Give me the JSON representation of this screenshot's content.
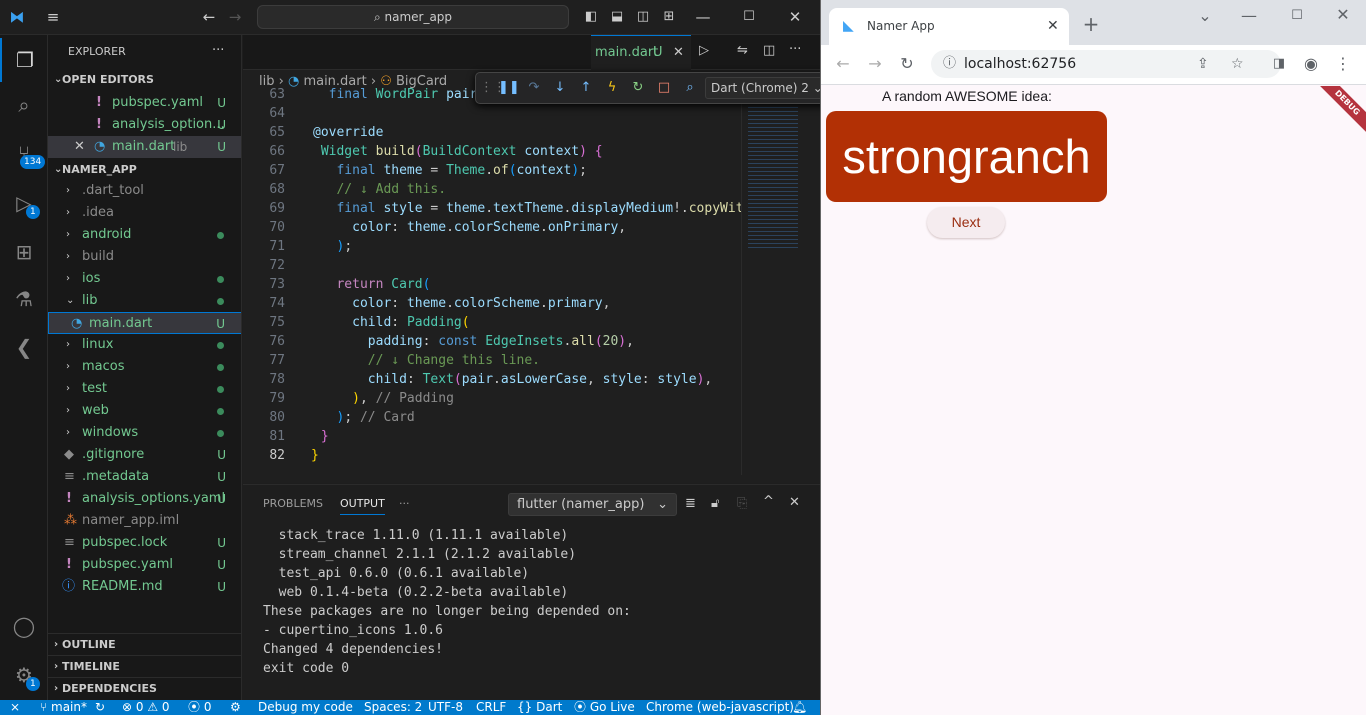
{
  "vscode": {
    "command_center": "namer_app",
    "explorer_title": "EXPLORER",
    "open_editors_title": "OPEN EDITORS",
    "open_editors": [
      {
        "name": "pubspec.yaml",
        "status": "U"
      },
      {
        "name": "analysis_option...",
        "status": "U"
      },
      {
        "name": "main.dart",
        "hint": "lib",
        "status": "U"
      }
    ],
    "project_title": "NAMER_APP",
    "tree": [
      {
        "name": ".dart_tool",
        "kind": "folder",
        "status": ""
      },
      {
        "name": ".idea",
        "kind": "folder",
        "status": ""
      },
      {
        "name": "android",
        "kind": "folder",
        "status": "dot"
      },
      {
        "name": "build",
        "kind": "folder",
        "status": ""
      },
      {
        "name": "ios",
        "kind": "folder",
        "status": "dot"
      },
      {
        "name": "lib",
        "kind": "folder-open",
        "status": "dot"
      },
      {
        "name": "main.dart",
        "kind": "file",
        "status": "U"
      },
      {
        "name": "linux",
        "kind": "folder",
        "status": "dot"
      },
      {
        "name": "macos",
        "kind": "folder",
        "status": "dot"
      },
      {
        "name": "test",
        "kind": "folder",
        "status": "dot"
      },
      {
        "name": "web",
        "kind": "folder",
        "status": "dot"
      },
      {
        "name": "windows",
        "kind": "folder",
        "status": "dot"
      },
      {
        "name": ".gitignore",
        "kind": "file",
        "status": "U"
      },
      {
        "name": ".metadata",
        "kind": "file",
        "status": "U"
      },
      {
        "name": "analysis_options.yaml",
        "kind": "file",
        "status": "U"
      },
      {
        "name": "namer_app.iml",
        "kind": "file",
        "status": ""
      },
      {
        "name": "pubspec.lock",
        "kind": "file",
        "status": "U"
      },
      {
        "name": "pubspec.yaml",
        "kind": "file",
        "status": "U"
      },
      {
        "name": "README.md",
        "kind": "file",
        "status": "U"
      }
    ],
    "bottom_sections": [
      "OUTLINE",
      "TIMELINE",
      "DEPENDENCIES"
    ],
    "badges": {
      "scm": "134",
      "debug": "1",
      "settings": "1"
    },
    "tab": {
      "name": "main.dart",
      "status": "U"
    },
    "debug_target": "Dart (Chrome) 2",
    "breadcrumb": [
      "lib",
      "main.dart",
      "BigCard"
    ],
    "line_numbers": [
      "63",
      "64",
      "65",
      "66",
      "67",
      "68",
      "69",
      "70",
      "71",
      "72",
      "73",
      "74",
      "75",
      "76",
      "77",
      "78",
      "79",
      "80",
      "81",
      "82"
    ],
    "panel_tabs": {
      "problems": "PROBLEMS",
      "output": "OUTPUT",
      "more": "···"
    },
    "output_channel": "flutter (namer_app)",
    "output_lines": [
      "  stack_trace 1.11.0 (1.11.1 available)",
      "  stream_channel 2.1.1 (2.1.2 available)",
      "  test_api 0.6.0 (0.6.1 available)",
      "  web 0.1.4-beta (0.2.2-beta available)",
      "These packages are no longer being depended on:",
      "- cupertino_icons 1.0.6",
      "Changed 4 dependencies!",
      "exit code 0"
    ],
    "status": {
      "branch": "main*",
      "errors": "0",
      "warnings": "0",
      "ports": "0",
      "debug": "Debug my code",
      "spaces": "Spaces: 2",
      "encoding": "UTF-8",
      "eol": "CRLF",
      "language": "Dart",
      "golive": "Go Live",
      "device": "Chrome (web-javascript)"
    }
  },
  "browser": {
    "tab_title": "Namer App",
    "url": "localhost:62756",
    "app": {
      "prompt": "A random AWESOME idea:",
      "word": "strongranch",
      "next_label": "Next",
      "debug_banner": "DEBUG"
    }
  }
}
